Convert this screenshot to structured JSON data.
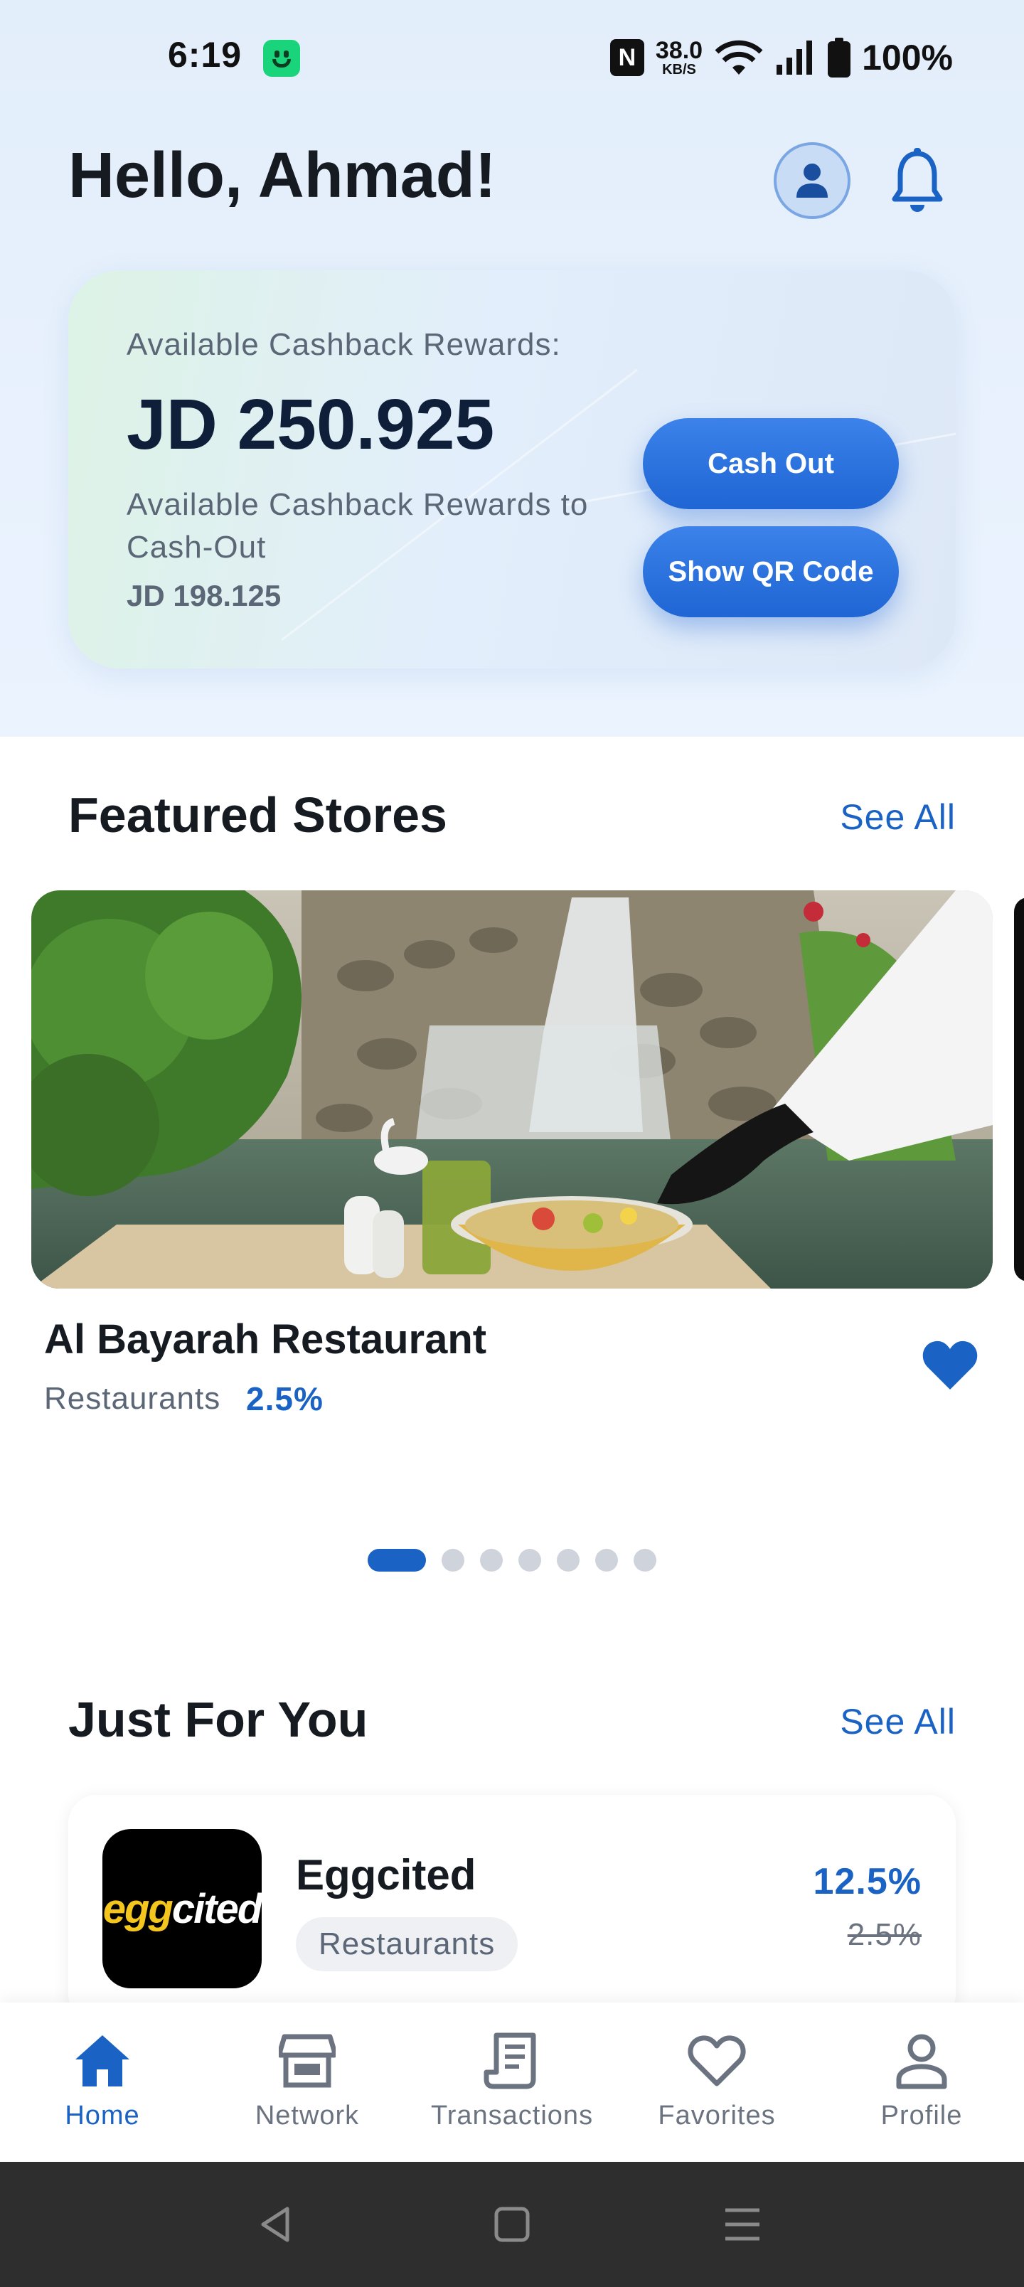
{
  "status_bar": {
    "time": "6:19",
    "nfc": "N",
    "speed_value": "38.0",
    "speed_unit": "KB/S",
    "battery": "100%"
  },
  "header": {
    "greeting": "Hello, Ahmad!"
  },
  "rewards": {
    "label": "Available Cashback Rewards:",
    "amount": "JD 250.925",
    "cashout_label": "Available Cashback Rewards to Cash-Out",
    "cashout_amount": "JD 198.125",
    "cash_out_button": "Cash Out",
    "qr_button": "Show QR Code"
  },
  "featured": {
    "title": "Featured Stores",
    "see_all": "See All",
    "store": {
      "name": "Al Bayarah Restaurant",
      "category": "Restaurants",
      "cashback": "2.5%",
      "favorited": true
    },
    "carousel": {
      "count": 7,
      "active_index": 0
    }
  },
  "just_for_you": {
    "title": "Just For You",
    "see_all": "See All",
    "offer": {
      "logo_text_a": "egg",
      "logo_text_b": "cited",
      "name": "Eggcited",
      "category": "Restaurants",
      "cashback": "12.5%",
      "previous_cashback": "2.5%"
    }
  },
  "bottom_nav": {
    "items": [
      {
        "label": "Home",
        "icon": "home-icon",
        "active": true
      },
      {
        "label": "Network",
        "icon": "store-icon",
        "active": false
      },
      {
        "label": "Transactions",
        "icon": "receipt-icon",
        "active": false
      },
      {
        "label": "Favorites",
        "icon": "heart-icon",
        "active": false
      },
      {
        "label": "Profile",
        "icon": "person-icon",
        "active": false
      }
    ]
  },
  "colors": {
    "accent": "#1a62c4",
    "button": "#2a6fdc",
    "text": "#161b22",
    "muted": "#5b6676"
  }
}
